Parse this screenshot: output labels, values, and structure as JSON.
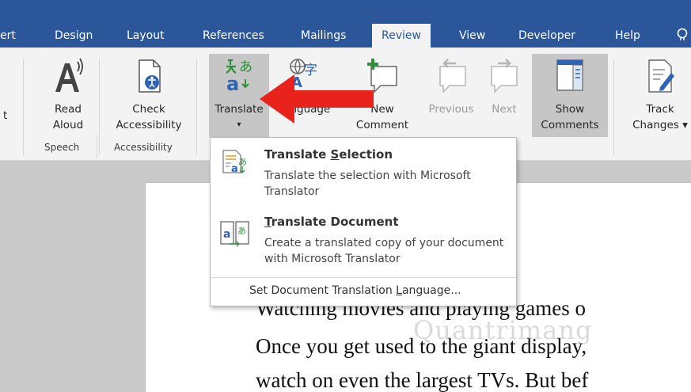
{
  "tabs": [
    {
      "label": "ert"
    },
    {
      "label": "Design"
    },
    {
      "label": "Layout"
    },
    {
      "label": "References"
    },
    {
      "label": "Mailings"
    },
    {
      "label": "Review"
    },
    {
      "label": "View"
    },
    {
      "label": "Developer"
    },
    {
      "label": "Help"
    }
  ],
  "ribbon": {
    "left_cut_label": "t",
    "read_aloud": {
      "line1": "Read",
      "line2": "Aloud"
    },
    "check_accessibility": {
      "line1": "Check",
      "line2": "Accessibility"
    },
    "translate": {
      "line1": "Translate",
      "line2": "▾"
    },
    "language": {
      "line1": "Language"
    },
    "new_comment": {
      "line1": "New",
      "line2": "Comment"
    },
    "previous": {
      "line1": "Previous"
    },
    "next": {
      "line1": "Next"
    },
    "show_comments": {
      "line1": "Show",
      "line2": "Comments"
    },
    "track_changes": {
      "line1": "Track",
      "line2": "Changes ▾"
    },
    "groups": {
      "speech": "Speech",
      "accessibility": "Accessibility"
    }
  },
  "menu": {
    "translate_selection": {
      "title_pre": "Translate ",
      "title_key": "S",
      "title_post": "election",
      "desc": "Translate the selection with Microsoft Translator"
    },
    "translate_document": {
      "title_key": "T",
      "title_post": "ranslate Document",
      "desc": "Create a translated copy of your document with Microsoft Translator"
    },
    "set_language": {
      "pre": "Set Document Translation ",
      "key": "L",
      "post": "anguage..."
    }
  },
  "document": {
    "lines": [
      "Watching movies and playing games o",
      "Once you get used to the giant display,",
      "watch on even the largest TVs. But bef"
    ],
    "watermark": "Quantrimang"
  },
  "colors": {
    "tab_bar": "#2b579a",
    "ribbon_bg": "#f3f3f3",
    "arrow": "#e8231b",
    "translator_green": "#2f8f3a",
    "translator_blue": "#2f63b5"
  }
}
